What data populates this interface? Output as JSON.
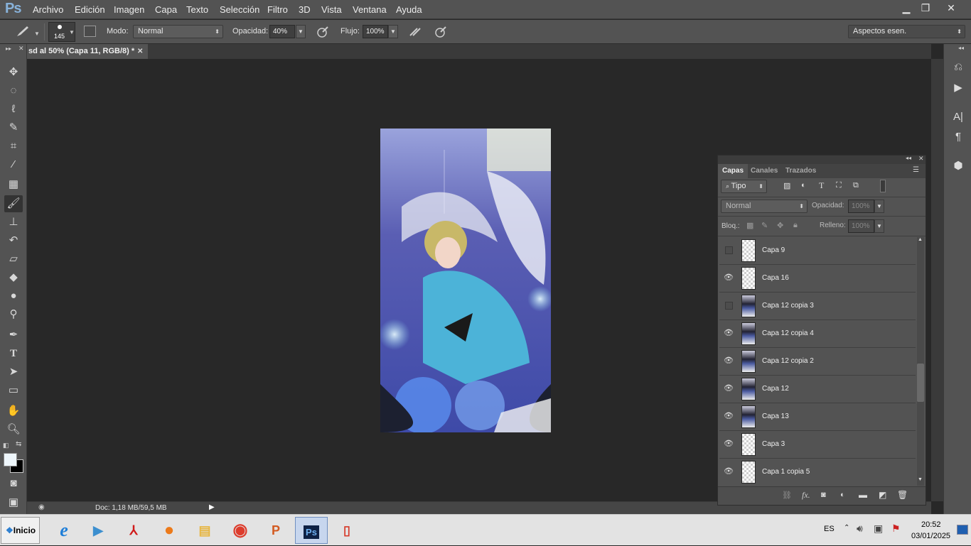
{
  "menu": {
    "logo": "Ps",
    "items": [
      "Archivo",
      "Edición",
      "Imagen",
      "Capa",
      "Texto",
      "Selección",
      "Filtro",
      "3D",
      "Vista",
      "Ventana",
      "Ayuda"
    ]
  },
  "window_controls": {
    "minimize": "▁",
    "restore": "❐",
    "close": "✕"
  },
  "options": {
    "brush_size": "145",
    "mode_label": "Modo:",
    "mode_value": "Normal",
    "opacity_label": "Opacidad:",
    "opacity_value": "40%",
    "flow_label": "Flujo:",
    "flow_value": "100%",
    "workspace": "Aspectos esen."
  },
  "doc_tab": {
    "title": "sd al 50% (Capa 11, RGB/8) *",
    "close": "✕"
  },
  "status": {
    "doc_info": "Doc: 1,18 MB/59,5 MB"
  },
  "layers_panel": {
    "tabs": [
      "Capas",
      "Canales",
      "Trazados"
    ],
    "filter_label": "Tipo",
    "blend_mode": "Normal",
    "opacity_label": "Opacidad:",
    "opacity_value": "100%",
    "lock_label": "Bloq.:",
    "fill_label": "Relleno:",
    "fill_value": "100%",
    "layers": [
      {
        "name": "Capa 9",
        "visible": false,
        "thumb": "blank"
      },
      {
        "name": "Capa 16",
        "visible": true,
        "thumb": "blank"
      },
      {
        "name": "Capa 12 copia 3",
        "visible": false,
        "thumb": "image"
      },
      {
        "name": "Capa 12 copia 4",
        "visible": true,
        "thumb": "image"
      },
      {
        "name": "Capa 12 copia 2",
        "visible": true,
        "thumb": "image"
      },
      {
        "name": "Capa 12",
        "visible": true,
        "thumb": "image"
      },
      {
        "name": "Capa 13",
        "visible": true,
        "thumb": "image"
      },
      {
        "name": "Capa 3",
        "visible": true,
        "thumb": "blank"
      },
      {
        "name": "Capa 1 copia 5",
        "visible": true,
        "thumb": "blank"
      }
    ],
    "footer_icons": [
      "link-icon",
      "fx-icon",
      "mask-icon",
      "adjustment-icon",
      "folder-icon",
      "new-layer-icon",
      "trash-icon"
    ]
  },
  "taskbar": {
    "start_label": "Inicio",
    "apps": [
      "ie",
      "media-player",
      "acrobat",
      "firefox",
      "explorer",
      "chrome",
      "powerpoint",
      "photoshop",
      "office"
    ],
    "active_app": "photoshop",
    "language": "ES",
    "time": "20:52",
    "date": "03/01/2025"
  },
  "colors": {
    "panel_bg": "#535353",
    "canvas_bg": "#282828",
    "accent": "#88b2da"
  }
}
